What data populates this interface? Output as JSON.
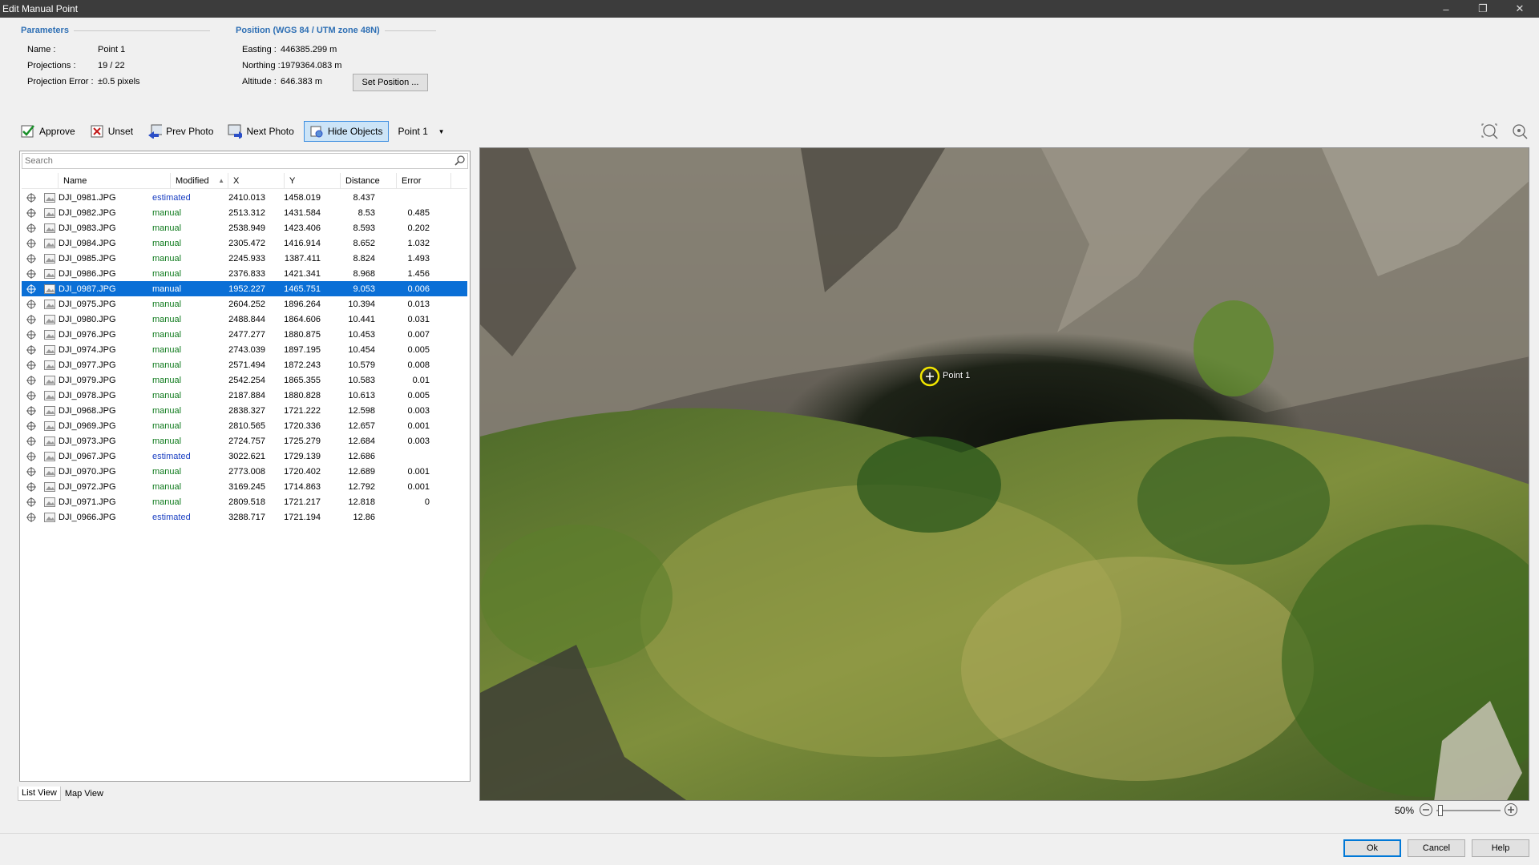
{
  "window": {
    "title": "Edit Manual Point"
  },
  "parameters": {
    "heading": "Parameters",
    "name_label": "Name :",
    "name_value": "Point 1",
    "projections_label": "Projections :",
    "projections_value": "19 / 22",
    "projection_error_label": "Projection Error :",
    "projection_error_value": "±0.5 pixels"
  },
  "position": {
    "heading": "Position (WGS 84 / UTM zone 48N)",
    "easting_label": "Easting :",
    "easting_value": "446385.299 m",
    "northing_label": "Northing :",
    "northing_value": "1979364.083 m",
    "altitude_label": "Altitude :",
    "altitude_value": "646.383 m",
    "set_position_button": "Set Position ..."
  },
  "toolbar": {
    "approve": "Approve",
    "unset": "Unset",
    "prev_photo": "Prev Photo",
    "next_photo": "Next Photo",
    "hide_objects": "Hide Objects",
    "point_select": "Point 1"
  },
  "search": {
    "placeholder": "Search"
  },
  "table": {
    "columns": [
      "Name",
      "Modified",
      "X",
      "Y",
      "Distance",
      "Error"
    ],
    "rows": [
      {
        "name": "DJI_0981.JPG",
        "modified": "estimated",
        "x": "2410.013",
        "y": "1458.019",
        "distance": "8.437",
        "error": ""
      },
      {
        "name": "DJI_0982.JPG",
        "modified": "manual",
        "x": "2513.312",
        "y": "1431.584",
        "distance": "8.53",
        "error": "0.485"
      },
      {
        "name": "DJI_0983.JPG",
        "modified": "manual",
        "x": "2538.949",
        "y": "1423.406",
        "distance": "8.593",
        "error": "0.202"
      },
      {
        "name": "DJI_0984.JPG",
        "modified": "manual",
        "x": "2305.472",
        "y": "1416.914",
        "distance": "8.652",
        "error": "1.032"
      },
      {
        "name": "DJI_0985.JPG",
        "modified": "manual",
        "x": "2245.933",
        "y": "1387.411",
        "distance": "8.824",
        "error": "1.493"
      },
      {
        "name": "DJI_0986.JPG",
        "modified": "manual",
        "x": "2376.833",
        "y": "1421.341",
        "distance": "8.968",
        "error": "1.456"
      },
      {
        "name": "DJI_0987.JPG",
        "modified": "manual",
        "x": "1952.227",
        "y": "1465.751",
        "distance": "9.053",
        "error": "0.006",
        "selected": true
      },
      {
        "name": "DJI_0975.JPG",
        "modified": "manual",
        "x": "2604.252",
        "y": "1896.264",
        "distance": "10.394",
        "error": "0.013"
      },
      {
        "name": "DJI_0980.JPG",
        "modified": "manual",
        "x": "2488.844",
        "y": "1864.606",
        "distance": "10.441",
        "error": "0.031"
      },
      {
        "name": "DJI_0976.JPG",
        "modified": "manual",
        "x": "2477.277",
        "y": "1880.875",
        "distance": "10.453",
        "error": "0.007"
      },
      {
        "name": "DJI_0974.JPG",
        "modified": "manual",
        "x": "2743.039",
        "y": "1897.195",
        "distance": "10.454",
        "error": "0.005"
      },
      {
        "name": "DJI_0977.JPG",
        "modified": "manual",
        "x": "2571.494",
        "y": "1872.243",
        "distance": "10.579",
        "error": "0.008"
      },
      {
        "name": "DJI_0979.JPG",
        "modified": "manual",
        "x": "2542.254",
        "y": "1865.355",
        "distance": "10.583",
        "error": "0.01"
      },
      {
        "name": "DJI_0978.JPG",
        "modified": "manual",
        "x": "2187.884",
        "y": "1880.828",
        "distance": "10.613",
        "error": "0.005"
      },
      {
        "name": "DJI_0968.JPG",
        "modified": "manual",
        "x": "2838.327",
        "y": "1721.222",
        "distance": "12.598",
        "error": "0.003"
      },
      {
        "name": "DJI_0969.JPG",
        "modified": "manual",
        "x": "2810.565",
        "y": "1720.336",
        "distance": "12.657",
        "error": "0.001"
      },
      {
        "name": "DJI_0973.JPG",
        "modified": "manual",
        "x": "2724.757",
        "y": "1725.279",
        "distance": "12.684",
        "error": "0.003"
      },
      {
        "name": "DJI_0967.JPG",
        "modified": "estimated",
        "x": "3022.621",
        "y": "1729.139",
        "distance": "12.686",
        "error": ""
      },
      {
        "name": "DJI_0970.JPG",
        "modified": "manual",
        "x": "2773.008",
        "y": "1720.402",
        "distance": "12.689",
        "error": "0.001"
      },
      {
        "name": "DJI_0972.JPG",
        "modified": "manual",
        "x": "3169.245",
        "y": "1714.863",
        "distance": "12.792",
        "error": "0.001"
      },
      {
        "name": "DJI_0971.JPG",
        "modified": "manual",
        "x": "2809.518",
        "y": "1721.217",
        "distance": "12.818",
        "error": "0"
      },
      {
        "name": "DJI_0966.JPG",
        "modified": "estimated",
        "x": "3288.717",
        "y": "1721.194",
        "distance": "12.86",
        "error": ""
      }
    ]
  },
  "tabs": [
    "List View",
    "Map View"
  ],
  "viewer": {
    "marker_label": "Point 1"
  },
  "zoom": {
    "level": "50%"
  },
  "dialog": {
    "ok": "Ok",
    "cancel": "Cancel",
    "help": "Help"
  },
  "colors": {
    "estimated": "#1a3fc2",
    "manual": "#0e7a1c",
    "selection": "#0a6fd6",
    "marker": "#f2e600"
  }
}
